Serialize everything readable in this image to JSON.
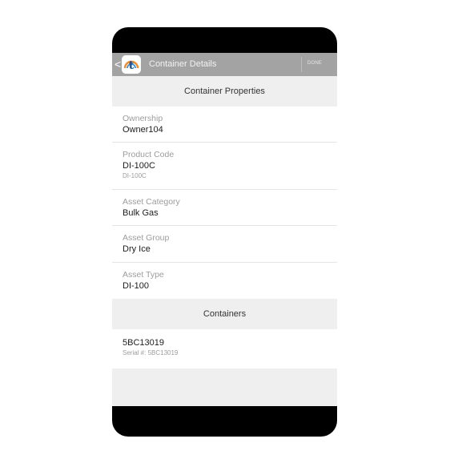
{
  "appbar": {
    "back_glyph": "<",
    "logo_letter": "t",
    "title": "Container Details",
    "done_label": "DONE"
  },
  "properties": {
    "header": "Container Properties",
    "ownership": {
      "label": "Ownership",
      "value": "Owner104"
    },
    "product_code": {
      "label": "Product Code",
      "value": "DI-100C",
      "sub": "DI-100C"
    },
    "asset_category": {
      "label": "Asset Category",
      "value": "Bulk Gas"
    },
    "asset_group": {
      "label": "Asset Group",
      "value": "Dry Ice"
    },
    "asset_type": {
      "label": "Asset Type",
      "value": "DI-100"
    }
  },
  "containers": {
    "header": "Containers",
    "items": [
      {
        "id": "5BC13019",
        "serial": "Serial #: 5BC13019"
      }
    ]
  },
  "icons": {
    "back": "chevron-left-icon",
    "app": "app-logo-icon"
  },
  "colors": {
    "appbar": "#a3a3a3",
    "background": "#efefef",
    "card": "#ffffff",
    "logo_blue": "#1f4e8c",
    "logo_arc_orange": "#f28c28",
    "logo_arc_blue": "#3a8fd6"
  }
}
